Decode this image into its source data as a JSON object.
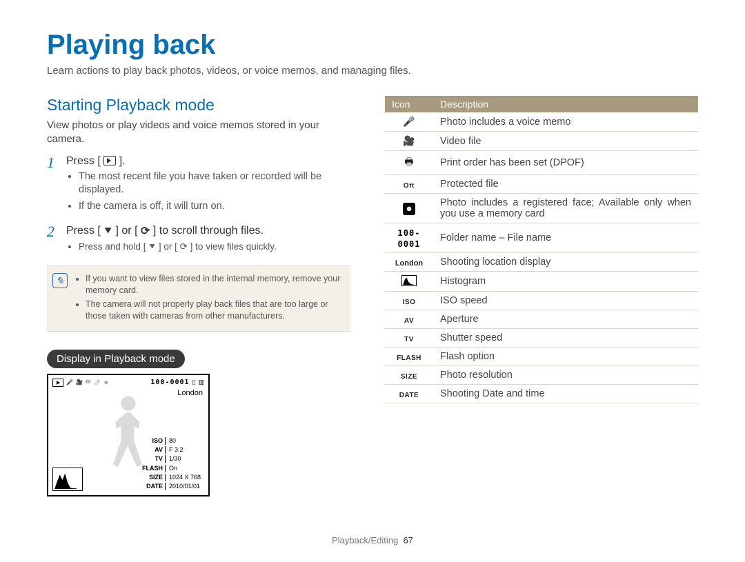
{
  "title": "Playing back",
  "intro": "Learn actions to play back photos, videos, or voice memos, and managing files.",
  "section_heading": "Starting Playback mode",
  "section_intro": "View photos or play videos and voice memos stored in your camera.",
  "steps": [
    {
      "num": "1",
      "line_prefix": "Press [",
      "line_suffix": "].",
      "bullets": [
        "The most recent file you have taken or recorded will be displayed.",
        "If the camera is off, it will turn on."
      ]
    },
    {
      "num": "2",
      "line_prefix": "Press [",
      "mid1": "] or [",
      "line_suffix": "] to scroll through files.",
      "bullets": [
        "Press and hold [ ⯆ ] or [ ⟳ ] to view files quickly."
      ]
    }
  ],
  "notes": [
    "If you want to view files stored in the internal memory, remove your memory card.",
    "The camera will not properly play back files that are too large or those taken with cameras from other manufacturers."
  ],
  "pill": "Display in Playback mode",
  "screen": {
    "folder_file": "100-0001",
    "location": "London",
    "info": {
      "ISO": "80",
      "AV": "F 3.2",
      "TV": "1/30",
      "FLASH": "On",
      "SIZE": "1024 X 768",
      "DATE": "2010/01/01"
    }
  },
  "table": {
    "head_icon": "Icon",
    "head_desc": "Description",
    "rows": [
      {
        "icon_name": "voice-memo-icon",
        "icon_glyph": "🎤",
        "desc": "Photo includes a voice memo"
      },
      {
        "icon_name": "video-icon",
        "icon_glyph": "🎥",
        "desc": "Video file"
      },
      {
        "icon_name": "print-icon",
        "icon_glyph": "🖶",
        "desc": "Print order has been set (DPOF)"
      },
      {
        "icon_name": "protected-icon",
        "icon_glyph": "🗝",
        "label": "Oπ",
        "desc": "Protected file"
      },
      {
        "icon_name": "face-icon",
        "icon_glyph": "face",
        "desc": "Photo includes a registered face; Available only when you use a memory card"
      },
      {
        "icon_name": "folder-file-icon",
        "label": "100-0001",
        "desc": "Folder name – File name"
      },
      {
        "icon_name": "location-icon",
        "label": "London",
        "desc": "Shooting location display"
      },
      {
        "icon_name": "histogram-icon",
        "label": "hist",
        "desc": "Histogram"
      },
      {
        "icon_name": "iso-icon",
        "label": "ISO",
        "desc": "ISO speed"
      },
      {
        "icon_name": "av-icon",
        "label": "AV",
        "desc": "Aperture"
      },
      {
        "icon_name": "tv-icon",
        "label": "TV",
        "desc": "Shutter speed"
      },
      {
        "icon_name": "flash-icon",
        "label": "FLASH",
        "desc": "Flash option"
      },
      {
        "icon_name": "size-icon",
        "label": "SIZE",
        "desc": "Photo resolution"
      },
      {
        "icon_name": "date-icon",
        "label": "DATE",
        "desc": "Shooting Date and time"
      }
    ]
  },
  "footer_section": "Playback/Editing",
  "footer_page": "67"
}
